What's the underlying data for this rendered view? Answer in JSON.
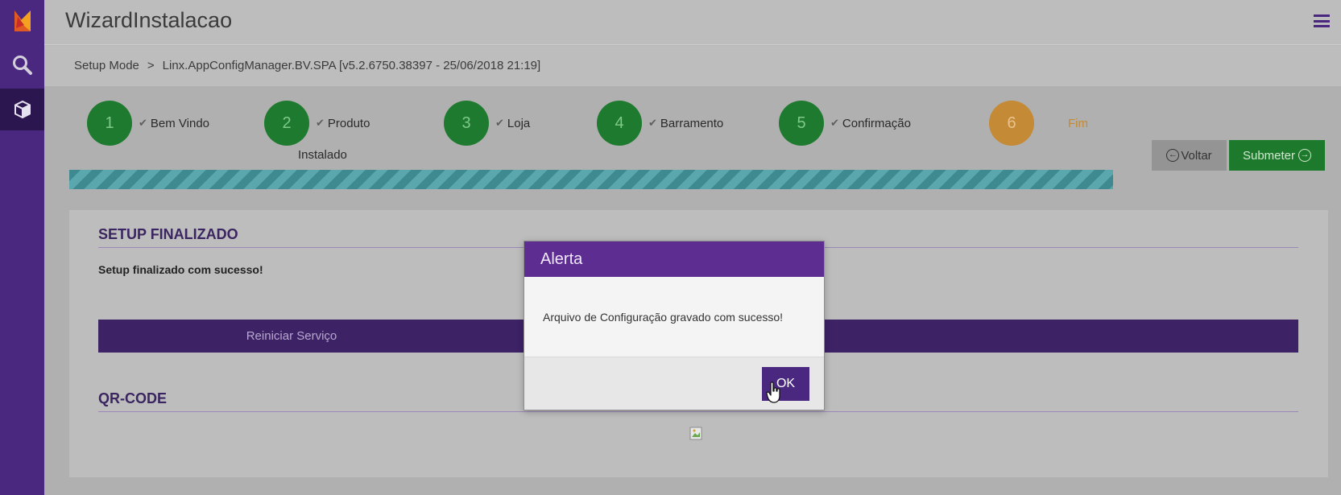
{
  "app": {
    "title": "WizardInstalacao"
  },
  "sidebar": {
    "icons": [
      "logo-icon",
      "search-icon",
      "cube-icon"
    ]
  },
  "breadcrumb": {
    "items": [
      "Setup Mode",
      ">",
      "Linx.AppConfigManager.BV.SPA [v5.2.6750.38397 - 25/06/2018 21:19]"
    ]
  },
  "wizard": {
    "steps": [
      {
        "number": "1",
        "label": "Bem Vindo",
        "done": true
      },
      {
        "number": "2",
        "label": "Produto",
        "sublabel": "Instalado",
        "done": true
      },
      {
        "number": "3",
        "label": "Loja",
        "done": true
      },
      {
        "number": "4",
        "label": "Barramento",
        "done": true
      },
      {
        "number": "5",
        "label": "Confirmação",
        "done": true
      },
      {
        "number": "6",
        "label": "Fim",
        "done": false
      }
    ],
    "progress": 1.0,
    "back_label": "Voltar",
    "submit_label": "Submeter"
  },
  "panel": {
    "setup_title": "SETUP FINALIZADO",
    "success_message": "Setup finalizado com sucesso!",
    "restart_label": "Reiniciar Serviço",
    "qr_title": "QR-CODE"
  },
  "modal": {
    "title": "Alerta",
    "message": "Arquivo de Configuração gravado com sucesso!",
    "ok_label": "OK"
  },
  "colors": {
    "brand": "#4b2880",
    "step_done": "#1e7a2e",
    "step_current": "#c48a35",
    "submit": "#1d7a2c"
  }
}
